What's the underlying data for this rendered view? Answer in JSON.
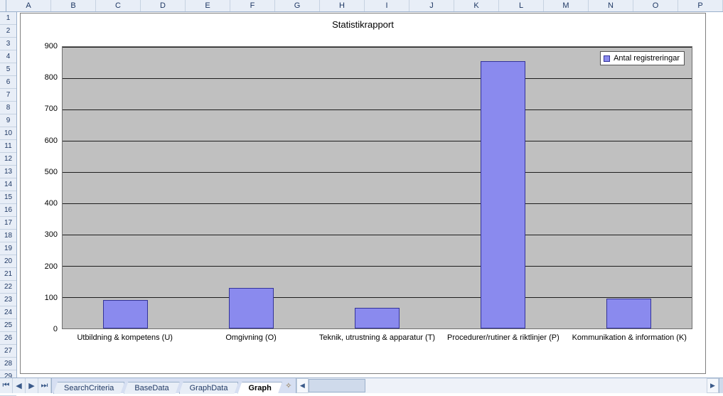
{
  "chart_data": {
    "type": "bar",
    "title": "Statistikrapport",
    "categories": [
      "Utbildning & kompetens (U)",
      "Omgivning (O)",
      "Teknik, utrustning & apparatur (T)",
      "Procedurer/rutiner & riktlinjer (P)",
      "Kommunikation & information (K)"
    ],
    "series": [
      {
        "name": "Antal registreringar",
        "values": [
          90,
          130,
          65,
          855,
          95
        ]
      }
    ],
    "ylim": [
      0,
      900
    ],
    "y_ticks": [
      0,
      100,
      200,
      300,
      400,
      500,
      600,
      700,
      800,
      900
    ],
    "xlabel": "",
    "ylabel": "",
    "grid": true,
    "legend_position": "top-right",
    "colors": {
      "bar_fill": "#8a8aee",
      "bar_border": "#333399",
      "plot_bg": "#c0c0c0"
    }
  },
  "spreadsheet": {
    "columns": [
      "A",
      "B",
      "C",
      "D",
      "E",
      "F",
      "G",
      "H",
      "I",
      "J",
      "K",
      "L",
      "M",
      "N",
      "O",
      "P"
    ],
    "row_count": 30
  },
  "tabs": {
    "nav": {
      "first": "⏮",
      "prev": "◀",
      "next": "▶",
      "last": "⏭"
    },
    "items": [
      {
        "label": "SearchCriteria",
        "active": false
      },
      {
        "label": "BaseData",
        "active": false
      },
      {
        "label": "GraphData",
        "active": false
      },
      {
        "label": "Graph",
        "active": true
      }
    ],
    "new_tab_glyph": "✧"
  },
  "scroll": {
    "left_glyph": "◀",
    "right_glyph": "▶",
    "thumb_glyph": "⋮⋮⋮"
  }
}
